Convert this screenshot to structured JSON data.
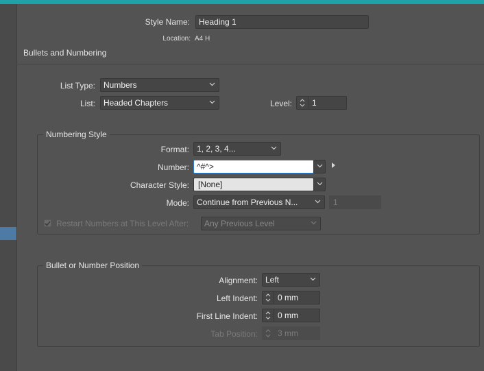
{
  "dialog": {
    "style_name_label": "Style Name:",
    "style_name_value": "Heading 1",
    "location_label": "Location:",
    "location_value": "A4 H",
    "section_title": "Bullets and Numbering"
  },
  "list": {
    "list_type_label": "List Type:",
    "list_type_value": "Numbers",
    "list_label": "List:",
    "list_value": "Headed Chapters",
    "level_label": "Level:",
    "level_value": "1"
  },
  "numbering_style": {
    "title": "Numbering Style",
    "format_label": "Format:",
    "format_value": "1, 2, 3, 4...",
    "number_label": "Number:",
    "number_value": "^#^>",
    "char_style_label": "Character Style:",
    "char_style_value": "[None]",
    "mode_label": "Mode:",
    "mode_value": "Continue from Previous N...",
    "mode_start_value": "1",
    "restart_label": "Restart Numbers at This Level After:",
    "restart_checked": true,
    "restart_value": "Any Previous Level"
  },
  "position": {
    "title": "Bullet or Number Position",
    "alignment_label": "Alignment:",
    "alignment_value": "Left",
    "left_indent_label": "Left Indent:",
    "left_indent_value": "0 mm",
    "first_line_label": "First Line Indent:",
    "first_line_value": "0 mm",
    "tab_position_label": "Tab Position:",
    "tab_position_value": "3 mm"
  },
  "colors": {
    "accent_bar": "#1fa3a8",
    "background": "#535353",
    "focus_border": "#2d7fd4"
  },
  "icons": {
    "dropdown": "chevron-down-icon",
    "spinner": "spinner-arrows-icon",
    "insert_special": "triangle-right-icon",
    "checkbox": "checkmark-icon"
  }
}
